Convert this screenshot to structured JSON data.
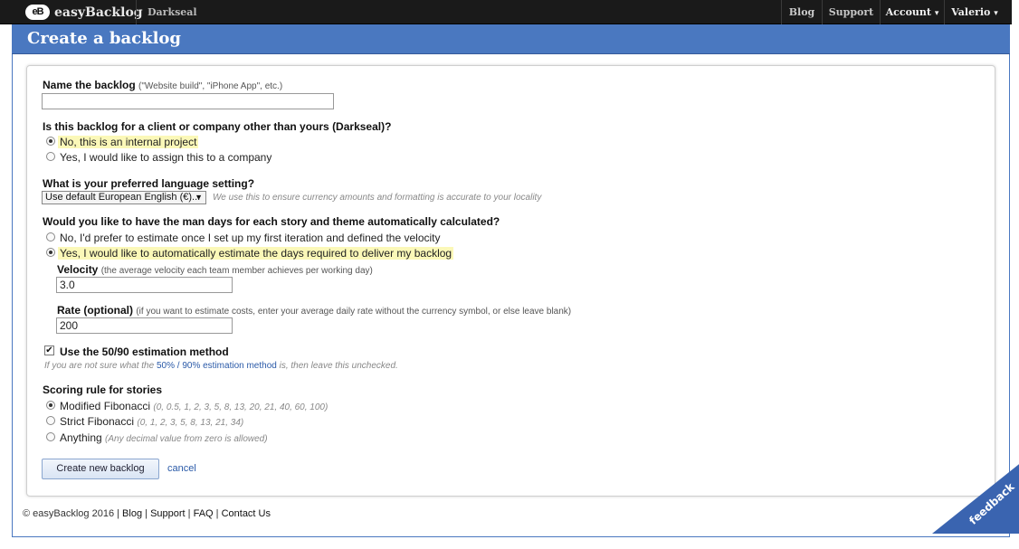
{
  "topbar": {
    "logo_badge": "eB",
    "app_name": "easyBacklog",
    "company": "Darkseal",
    "nav": {
      "blog": "Blog",
      "support": "Support",
      "account": "Account",
      "user": "Valerio",
      "caret": "▾"
    }
  },
  "header": {
    "title": "Create a backlog"
  },
  "form": {
    "name": {
      "label": "Name the backlog",
      "hint": "(\"Website build\", \"iPhone App\", etc.)",
      "value": "",
      "placeholder": ""
    },
    "client": {
      "question": "Is this backlog for a client or company other than yours (Darkseal)?",
      "options": [
        {
          "label": "No, this is an internal project",
          "selected": true
        },
        {
          "label": "Yes, I would like to assign this to a company",
          "selected": false
        }
      ]
    },
    "language": {
      "question": "What is your preferred language setting?",
      "selected": "Use default European English (€)...",
      "hint": "We use this to ensure currency amounts and formatting is accurate to your locality"
    },
    "mandays": {
      "question": "Would you like to have the man days for each story and theme automatically calculated?",
      "options": [
        {
          "label": "No, I'd prefer to estimate once I set up my first iteration and defined the velocity",
          "selected": false
        },
        {
          "label": "Yes, I would like to automatically estimate the days required to deliver my backlog",
          "selected": true
        }
      ],
      "velocity": {
        "label": "Velocity",
        "hint": "(the average velocity each team member achieves per working day)",
        "value": "3.0"
      },
      "rate": {
        "label": "Rate (optional)",
        "hint": "(if you want to estimate costs, enter your average daily rate without the currency symbol, or else leave blank)",
        "value": "200"
      }
    },
    "estimation": {
      "label": "Use the 50/90 estimation method",
      "checked": true,
      "hint_before": "If you are not sure what the ",
      "hint_link": "50% / 90% estimation method",
      "hint_after": " is, then leave this unchecked."
    },
    "scoring": {
      "question": "Scoring rule for stories",
      "options": [
        {
          "label": "Modified Fibonacci",
          "hint": "(0, 0.5, 1, 2, 3, 5, 8, 13, 20, 21, 40, 60, 100)",
          "selected": true
        },
        {
          "label": "Strict Fibonacci",
          "hint": "(0, 1, 2, 3, 5, 8, 13, 21, 34)",
          "selected": false
        },
        {
          "label": "Anything",
          "hint": "(Any decimal value from zero is allowed)",
          "selected": false
        }
      ]
    },
    "submit_label": "Create new backlog",
    "cancel_label": "cancel"
  },
  "footer": {
    "copyright": "© easyBacklog 2016",
    "links": [
      "Blog",
      "Support",
      "FAQ",
      "Contact Us"
    ]
  },
  "feedback_label": "feedback",
  "colors": {
    "header_blue": "#4a78c0",
    "topbar": "#1a1a1a",
    "highlight": "#fbf8b8",
    "link": "#2a5aa8"
  }
}
